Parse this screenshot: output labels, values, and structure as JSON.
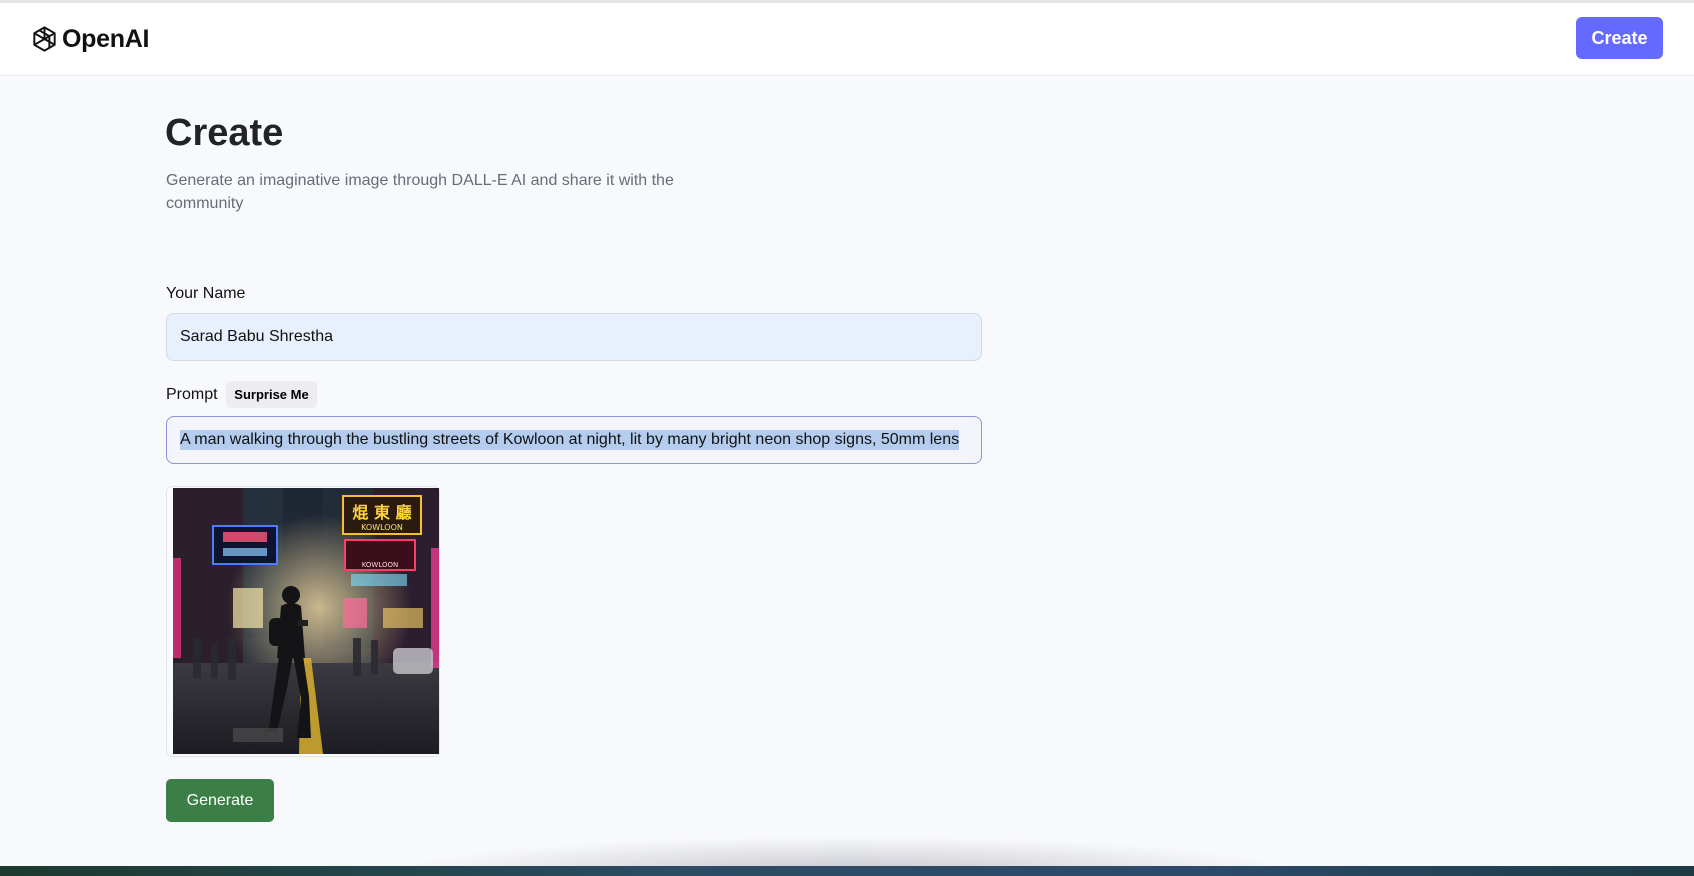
{
  "header": {
    "logo_text": "OpenAI",
    "create_label": "Create",
    "accent_color": "#6469ff"
  },
  "main": {
    "title": "Create",
    "subtitle": "Generate an imaginative image through DALL-E AI and share it with the community"
  },
  "form": {
    "name_label": "Your Name",
    "name_value": "Sarad Babu Shrestha",
    "prompt_label": "Prompt",
    "surprise_label": "Surprise Me",
    "prompt_value": "A man walking through the bustling streets of Kowloon at night, lit by many bright neon shop signs, 50mm lens",
    "generate_label": "Generate",
    "generate_color": "#3b7f47"
  },
  "image": {
    "description_icon": "generated-image",
    "signs": [
      "焜 東 廳",
      "KOWLOON",
      "KOWLOON"
    ]
  }
}
